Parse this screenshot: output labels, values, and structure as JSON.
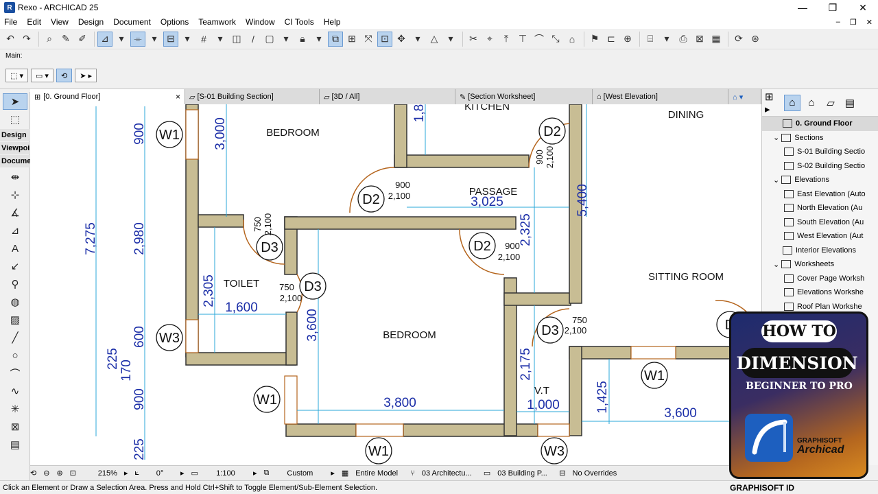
{
  "window": {
    "title": "Rexo - ARCHICAD 25",
    "app_icon": "R"
  },
  "menu": [
    "File",
    "Edit",
    "View",
    "Design",
    "Document",
    "Options",
    "Teamwork",
    "Window",
    "CI Tools",
    "Help"
  ],
  "infobox": {
    "label": "Main:"
  },
  "toolbox": {
    "design": "Design",
    "viewpoint": "Viewpoi",
    "document": "Docume"
  },
  "tabs": [
    {
      "label": "[0. Ground Floor]"
    },
    {
      "label": "[S-01 Building Section]"
    },
    {
      "label": "[3D / All]"
    },
    {
      "label": "[Section Worksheet]"
    },
    {
      "label": "[West Elevation]"
    }
  ],
  "tab_close": "×",
  "navigator": {
    "items": [
      {
        "label": "0. Ground Floor",
        "selected": true
      },
      {
        "label": "Sections"
      },
      {
        "label": "S-01 Building Sectio"
      },
      {
        "label": "S-02 Building Sectio"
      },
      {
        "label": "Elevations"
      },
      {
        "label": "East Elevation (Auto"
      },
      {
        "label": "North Elevation (Au"
      },
      {
        "label": "South Elevation (Au"
      },
      {
        "label": "West Elevation (Aut"
      },
      {
        "label": "Interior Elevations"
      },
      {
        "label": "Worksheets"
      },
      {
        "label": "Cover Page Worksh"
      },
      {
        "label": "Elevations Workshe"
      },
      {
        "label": "Roof Plan Workshe"
      }
    ]
  },
  "plan": {
    "rooms": {
      "bedroom1": "BEDROOM",
      "kitchen": "KITCHEN",
      "dining": "DINING",
      "passage": "PASSAGE",
      "toilet": "TOILET",
      "bedroom2": "BEDROOM",
      "sitting": "SITTING ROOM",
      "vt": "V.T"
    },
    "dims": {
      "d7275": "7,275",
      "d2980": "2,980",
      "d900a": "900",
      "d3000": "3,000",
      "d18": "1,8",
      "d3025": "3,025",
      "d5400": "5,400",
      "d2325": "2,325",
      "d2305": "2,305",
      "d1600": "1,600",
      "d3600a": "3,600",
      "d600": "600",
      "d225a": "225",
      "d170": "170",
      "d900b": "900",
      "d225b": "225",
      "d3800": "3,800",
      "d2175": "2,175",
      "d1000": "1,000",
      "d1425": "1,425",
      "d3600b": "3,600"
    },
    "tags": {
      "w1a": "W1",
      "w3a": "W3",
      "w1b": "W1",
      "w1c": "W1",
      "w3b": "W3",
      "w1d": "W1",
      "d2a": "D2",
      "d2b": "D2",
      "d2c": "D2",
      "d3a": "D3",
      "d3b": "D3",
      "d3c": "D3",
      "dcut": "D"
    },
    "door_notes": {
      "d2a_w": "900",
      "d2a_h": "2,100",
      "d2b_w": "900",
      "d2b_h": "2,100",
      "d2c_w": "900",
      "d2c_h": "2,100",
      "d3a_w": "750",
      "d3a_h": "2,100",
      "d3b_w": "750",
      "d3b_h": "2,100",
      "d3c_w": "750",
      "d3c_h": "2,100"
    }
  },
  "statusbar": {
    "zoom": "215%",
    "angle": "0°",
    "scale": "1:100",
    "layer": "Custom",
    "model": "Entire Model",
    "pen": "03 Architectu...",
    "struct": "03 Building P...",
    "override": "No Overrides"
  },
  "hint": "Click an Element or Draw a Selection Area. Press and Hold Ctrl+Shift to Toggle Element/Sub-Element Selection.",
  "hint_brand": "GRAPHISOFT ID",
  "promo": {
    "line1": "HOW TO",
    "line2": "DIMENSION",
    "line3": "BEGINNER TO PRO",
    "brand1": "GRAPHISOFT",
    "brand2": "Archicad"
  },
  "colors": {
    "wall": "#c8bd94",
    "wall_stroke": "#333333",
    "dimension": "#1c2fa8",
    "dim_line": "#29a7d8",
    "door_arc": "#b5651d",
    "accent": "#1d5fbf"
  }
}
